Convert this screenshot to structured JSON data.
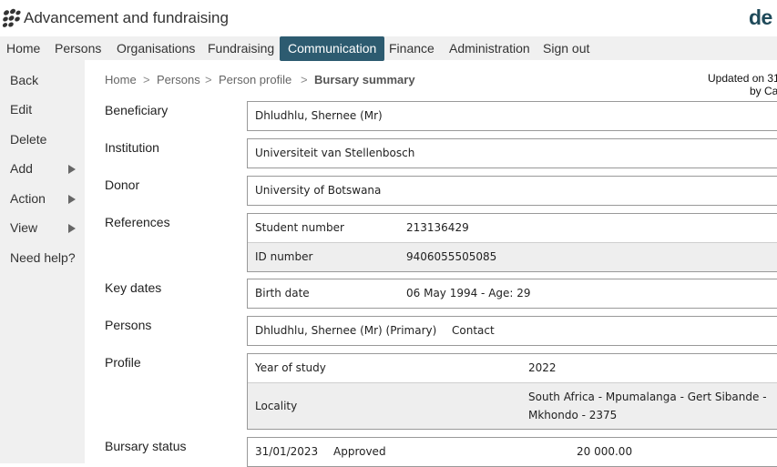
{
  "app": {
    "title": "Advancement and fundraising",
    "brand": "de"
  },
  "nav": [
    "Home",
    "Persons",
    "Organisations",
    "Fundraising",
    "Communication",
    "Finance",
    "Administration",
    "Sign out"
  ],
  "nav_active": "Communication",
  "sidebar": [
    "Back",
    "Edit",
    "Delete",
    "Add",
    "Action",
    "View",
    "Need help?"
  ],
  "breadcrumb": [
    "Home",
    "Persons",
    "Person profile",
    "Bursary summary"
  ],
  "breadcrumb_sep": ">",
  "updated": {
    "line1": "Updated on 31",
    "line2": "by Ca"
  },
  "fields": {
    "beneficiary": {
      "label": "Beneficiary",
      "value": "Dhludhlu, Shernee (Mr)"
    },
    "institution": {
      "label": "Institution",
      "value": "Universiteit van Stellenbosch"
    },
    "donor": {
      "label": "Donor",
      "value": "University of Botswana"
    },
    "references": {
      "label": "References",
      "rows": [
        {
          "name": "Student number",
          "value": "213136429"
        },
        {
          "name": "ID number",
          "value": "9406055505085"
        }
      ]
    },
    "key_dates": {
      "label": "Key dates",
      "name": "Birth date",
      "value": "06 May 1994 - Age: 29"
    },
    "persons": {
      "label": "Persons",
      "name": "Dhludhlu, Shernee (Mr) (Primary)",
      "role": "Contact"
    },
    "profile": {
      "label": "Profile",
      "year_label": "Year of study",
      "year_value": "2022",
      "locality_label": "Locality",
      "locality_line1": "South Africa - Mpumalanga - Gert Sibande -",
      "locality_line2": "Mkhondo - 2375"
    },
    "bursary_status": {
      "label": "Bursary status",
      "date": "31/01/2023",
      "status": "Approved",
      "amount": "20 000.00"
    }
  },
  "colors": {
    "nav_active_bg": "#2d5b70",
    "sidebar_bg": "#f0f0f0",
    "alt_row_bg": "#eeeeee"
  }
}
